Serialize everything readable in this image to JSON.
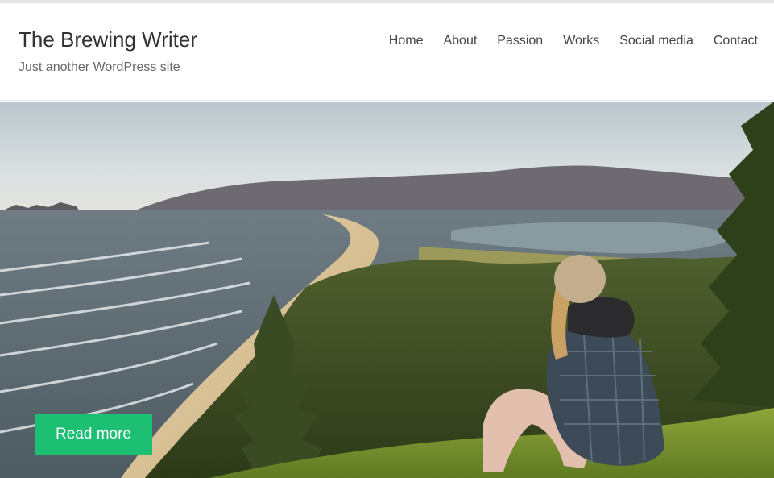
{
  "site": {
    "title": "The Brewing Writer",
    "tagline": "Just another WordPress site"
  },
  "nav": {
    "items": [
      {
        "label": "Home"
      },
      {
        "label": "About"
      },
      {
        "label": "Passion"
      },
      {
        "label": "Works"
      },
      {
        "label": "Social media"
      },
      {
        "label": "Contact"
      }
    ]
  },
  "hero": {
    "read_more_label": "Read more"
  },
  "colors": {
    "button": "#1dbf73",
    "header_bg": "#ffffff"
  }
}
